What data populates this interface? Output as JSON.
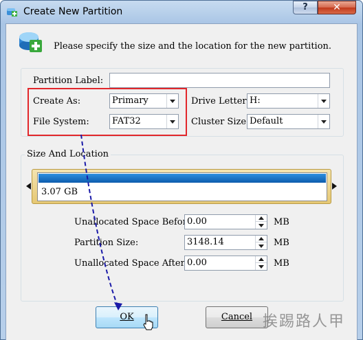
{
  "window": {
    "title": "Create New Partition",
    "help_label": "?",
    "close_label": "✕"
  },
  "header": {
    "text": "Please specify the size and the location for the new partition.",
    "icon": "add-partition-icon"
  },
  "form": {
    "partition_label": {
      "label": "Partition Label:",
      "value": ""
    },
    "create_as": {
      "label": "Create As:",
      "value": "Primary"
    },
    "file_system": {
      "label": "File System:",
      "value": "FAT32"
    },
    "drive_letter": {
      "label": "Drive Letter:",
      "value": "H:"
    },
    "cluster_size": {
      "label": "Cluster Size:",
      "value": "Default"
    }
  },
  "size_location": {
    "title": "Size And Location",
    "disk_size": "3.07 GB",
    "unallocated_before": {
      "label": "Unallocated Space Before:",
      "value": "0.00",
      "unit": "MB"
    },
    "partition_size": {
      "label": "Partition Size:",
      "value": "3148.14",
      "unit": "MB"
    },
    "unallocated_after": {
      "label": "Unallocated Space After:",
      "value": "0.00",
      "unit": "MB"
    }
  },
  "buttons": {
    "ok": "OK",
    "cancel": "Cancel"
  },
  "watermark": "挨踢路人甲",
  "colors": {
    "highlight_box": "#e2262a",
    "annotation_arrow": "#1a1aa8",
    "disk_bar": "#1a6fc4"
  }
}
